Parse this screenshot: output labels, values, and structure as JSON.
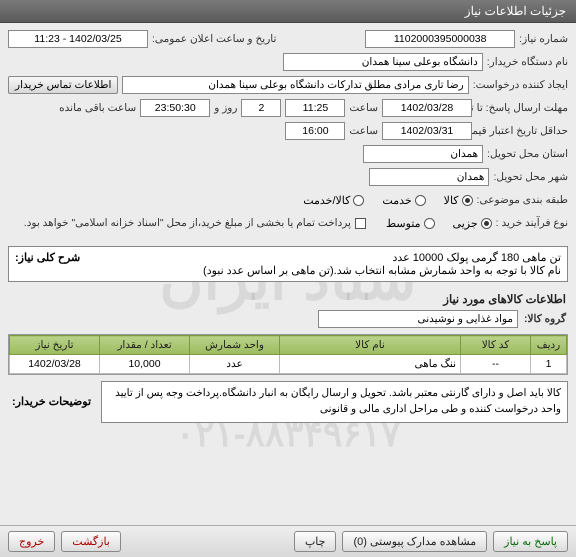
{
  "header": {
    "title": "جزئیات اطلاعات نیاز"
  },
  "form": {
    "need_no_label": "شماره نیاز:",
    "need_no": "1102000395000038",
    "announce_label": "تاریخ و ساعت اعلان عمومی:",
    "announce_value": "1402/03/25 - 11:23",
    "buyer_org_label": "نام دستگاه خریدار:",
    "buyer_org": "دانشگاه بوعلی سینا همدان",
    "requester_label": "ایجاد کننده درخواست:",
    "requester": "رضا تاری مرادی مطلق تدارکات دانشگاه بوعلی سینا همدان",
    "contact_btn": "اطلاعات تماس خریدار",
    "deadline_label": "مهلت ارسال پاسخ: تا تاریخ:",
    "deadline_date": "1402/03/28",
    "deadline_time_label": "ساعت",
    "deadline_time": "11:25",
    "days": "2",
    "days_label": "روز و",
    "remain_time": "23:50:30",
    "remain_label": "ساعت باقی مانده",
    "min_valid_label": "حداقل تاریخ اعتبار قیمت: تا تاریخ:",
    "min_valid_date": "1402/03/31",
    "min_valid_time": "16:00",
    "province_label": "استان محل تحویل:",
    "province": "همدان",
    "city_label": "شهر محل تحویل:",
    "city": "همدان",
    "class_label": "طبقه بندی موضوعی:",
    "class_options": {
      "kala": "کالا",
      "service": "خدمت",
      "kala_service": "کالا/خدمت"
    },
    "process_label": "نوع فرآیند خرید :",
    "process_options": {
      "partial": "جزیی",
      "medium": "متوسط"
    },
    "pay_note": "پرداخت تمام یا بخشی از مبلغ خرید،از محل \"اسناد خزانه اسلامی\" خواهد بود."
  },
  "desc": {
    "label": "شرح کلی نیاز:",
    "line1": "تن ماهی 180 گرمی پولک 10000 عدد",
    "line2": "نام کالا با توجه به واحد شمارش مشابه انتخاب شد.(تن ماهی بر اساس عدد نبود)"
  },
  "goods": {
    "section_title": "اطلاعات کالاهای مورد نیاز",
    "group_label": "گروه کالا:",
    "group_value": "مواد غذایی و نوشیدنی",
    "columns": {
      "row": "ردیف",
      "code": "کد کالا",
      "name": "نام کالا",
      "unit": "واحد شمارش",
      "qty": "تعداد / مقدار",
      "date": "تاریخ نیاز"
    },
    "rows": [
      {
        "row": "1",
        "code": "--",
        "name": "ننگ ماهی",
        "unit": "عدد",
        "qty": "10,000",
        "date": "1402/03/28"
      }
    ]
  },
  "buyer_note": {
    "label": "توضیحات خریدار:",
    "text": "کالا باید اصل و دارای گارنتی معتبر باشد. تحویل و ارسال رایگان به انبار دانشگاه.پرداخت وجه پس از تایید واحد درخواست کننده و طی مراحل اداری مالی و قانونی"
  },
  "buttons": {
    "respond": "پاسخ به نیاز",
    "attachments": "مشاهده مدارک پیوستی (0)",
    "print": "چاپ",
    "back": "بازگشت",
    "exit": "خروج"
  }
}
